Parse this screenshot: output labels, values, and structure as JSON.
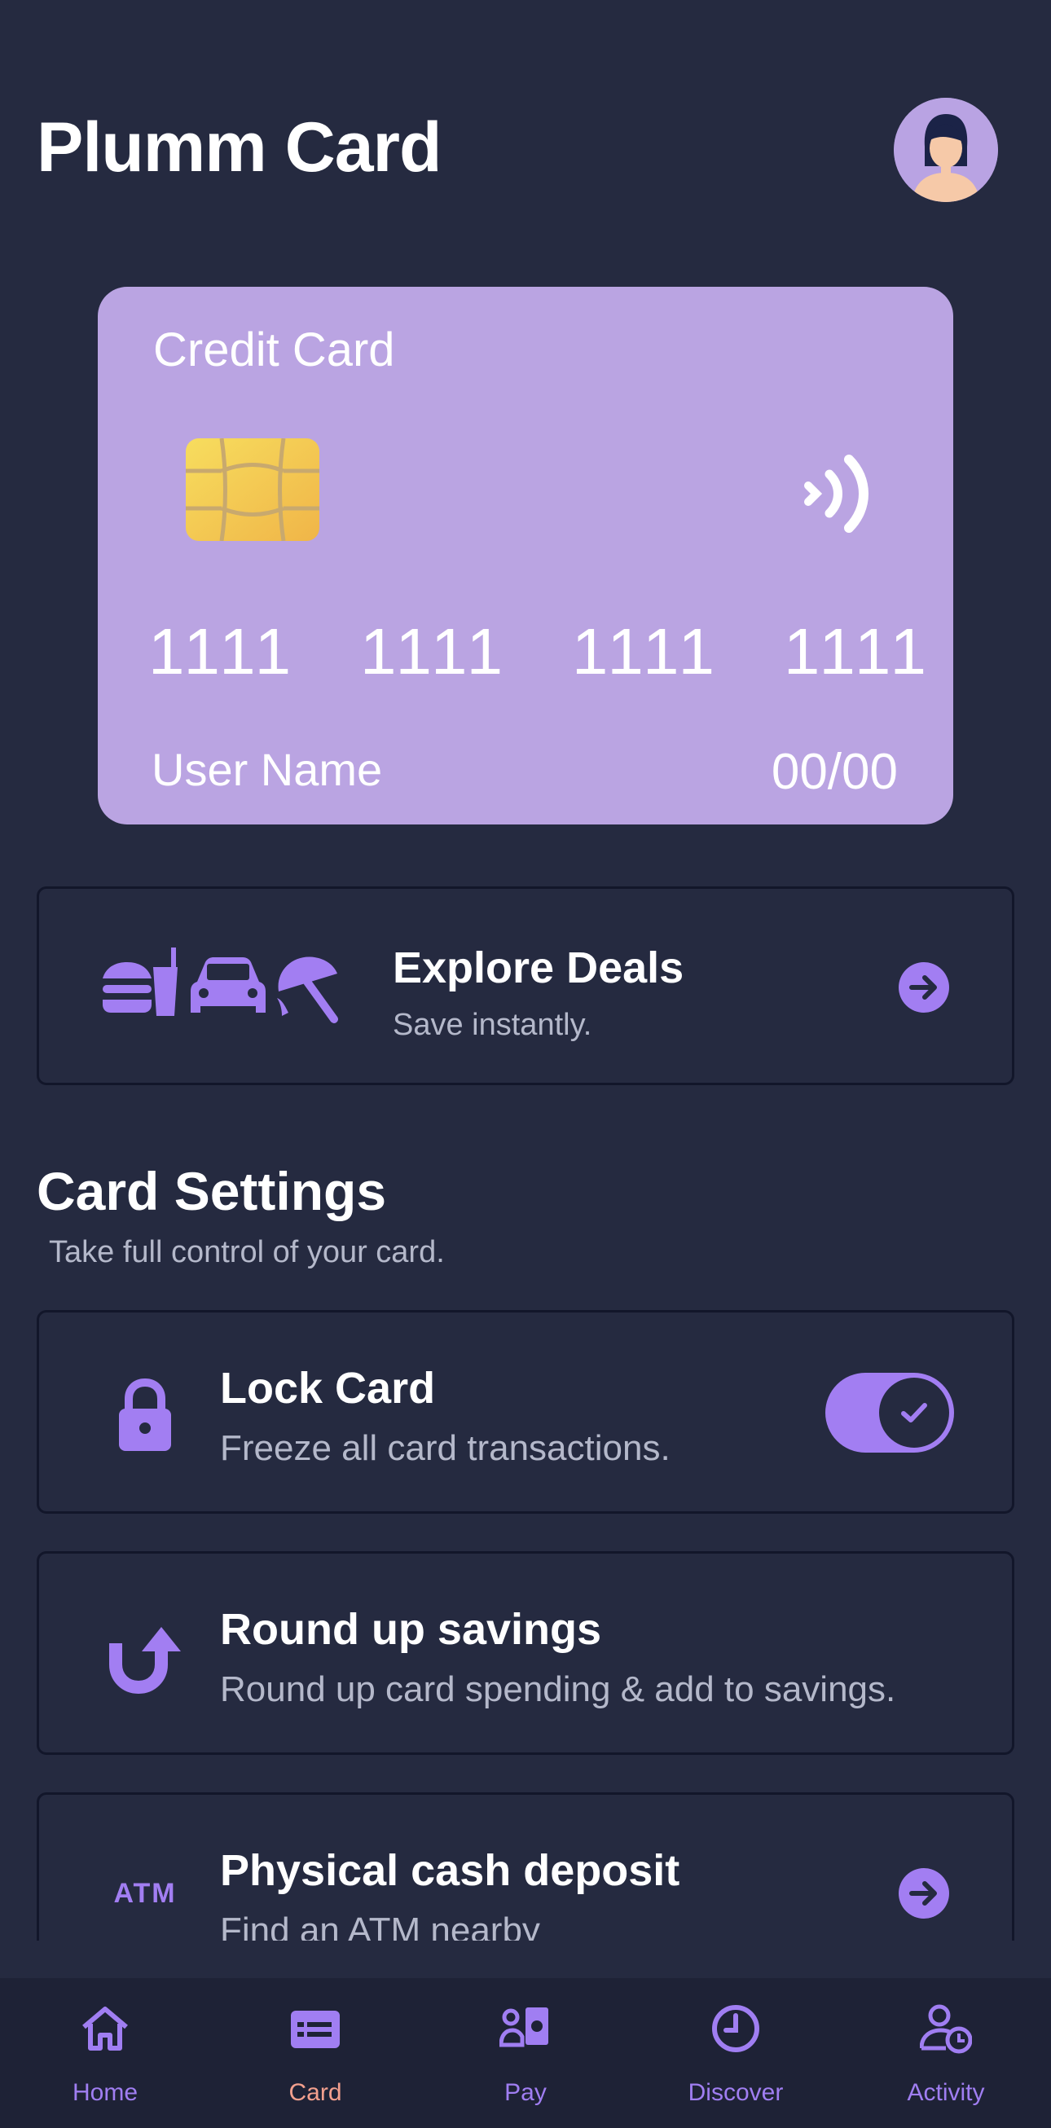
{
  "header": {
    "title": "Plumm Card"
  },
  "card": {
    "type_label": "Credit Card",
    "number_groups": [
      "1111",
      "1111",
      "1111",
      "1111"
    ],
    "holder_name": "User Name",
    "expiry": "00/00"
  },
  "deals": {
    "title": "Explore Deals",
    "subtitle": "Save instantly."
  },
  "card_settings": {
    "title": "Card Settings",
    "subtitle": "Take full control of your card.",
    "items": [
      {
        "title": "Lock Card",
        "subtitle": "Freeze all card transactions.",
        "icon": "lock-icon",
        "control": "toggle",
        "toggle_on": true
      },
      {
        "title": "Round up savings",
        "subtitle": "Round up card spending & add to savings.",
        "icon": "round-up-arrow-icon",
        "control": "none"
      },
      {
        "title": "Physical cash deposit",
        "subtitle": "Find an ATM nearby",
        "icon": "atm-icon",
        "control": "arrow"
      }
    ]
  },
  "tabbar": {
    "tabs": [
      {
        "label": "Home",
        "icon": "home-icon",
        "active": false
      },
      {
        "label": "Card",
        "icon": "card-icon",
        "active": true
      },
      {
        "label": "Pay",
        "icon": "pay-icon",
        "active": false
      },
      {
        "label": "Discover",
        "icon": "clock-icon",
        "active": false
      },
      {
        "label": "Activity",
        "icon": "user-clock-icon",
        "active": false
      }
    ]
  },
  "colors": {
    "background": "#252a40",
    "card": "#baa4e2",
    "accent": "#a27ef2",
    "active_tab": "#f3a08e",
    "muted_text": "#b4b8ca"
  }
}
